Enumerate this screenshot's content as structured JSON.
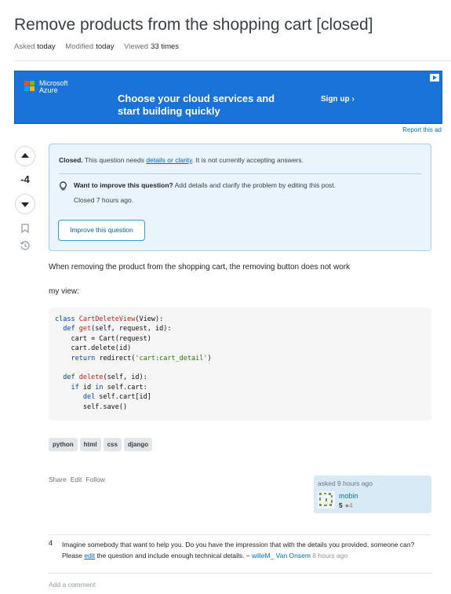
{
  "question": {
    "title": "Remove products from the shopping cart [closed]",
    "meta": {
      "asked_label": "Asked",
      "asked_value": "today",
      "modified_label": "Modified",
      "modified_value": "today",
      "viewed_label": "Viewed",
      "viewed_value": "33 times"
    }
  },
  "ad": {
    "brand_line1": "Microsoft",
    "brand_line2": "Azure",
    "headline": "Choose your cloud services and start building quickly",
    "cta": "Sign up ›",
    "report_label": "Report this ad",
    "colors": {
      "background": "#1a73d9",
      "logo_red": "#f25022",
      "logo_green": "#7fba00",
      "logo_blue": "#00a4ef",
      "logo_yellow": "#ffb900"
    }
  },
  "votes": {
    "score": "-4"
  },
  "notice": {
    "closed_label": "Closed.",
    "closed_text_before": " This question needs ",
    "closed_link": "details or clarity",
    "closed_text_after": ". It is not currently accepting answers.",
    "improve_heading": "Want to improve this question?",
    "improve_text_before": " Add details and clarify the problem by ",
    "improve_link": "editing this post",
    "improve_text_after": ".",
    "closed_time": "Closed 7 hours ago.",
    "button_label": "Improve this question"
  },
  "body": {
    "paragraph1": "When removing the product from the shopping cart, the removing button does not work",
    "paragraph2": "my view:"
  },
  "code": {
    "class_kw": "class",
    "class_name": "CartDeleteView",
    "class_rest": "(View):",
    "def_kw": "def",
    "get_name": "get",
    "get_args": "(self, request, id):",
    "line3": "cart = Cart(request)",
    "line4": "cart.delete(id)",
    "return_kw": "return",
    "return_rest_before": " redirect(",
    "return_str": "'cart:cart_detail'",
    "return_rest_after": ")",
    "delete_name": "delete",
    "delete_args": "(self, id):",
    "if_kw": "if",
    "if_mid": " id ",
    "in_kw": "in",
    "if_rest": " self.cart:",
    "del_kw": "del",
    "del_rest": " self.cart[id]",
    "last_line": "self.save()"
  },
  "tags": [
    "python",
    "html",
    "css",
    "django"
  ],
  "post_actions": {
    "share": "Share",
    "edit": "Edit",
    "follow": "Follow"
  },
  "owner": {
    "asked": "asked 9 hours ago",
    "name": "mobin",
    "reputation": "5",
    "bronze_badges": "●4"
  },
  "comment": {
    "score": "4",
    "text_before": "Imagine somebody that want to help you. Do you have the impression that with the details you provided, someone can? Please ",
    "edit_link": "edit",
    "text_after": " the question and include enough technical details. – ",
    "user": "willeM_ Van Onsem",
    "time": " 8 hours ago"
  },
  "add_comment": "Add a comment"
}
